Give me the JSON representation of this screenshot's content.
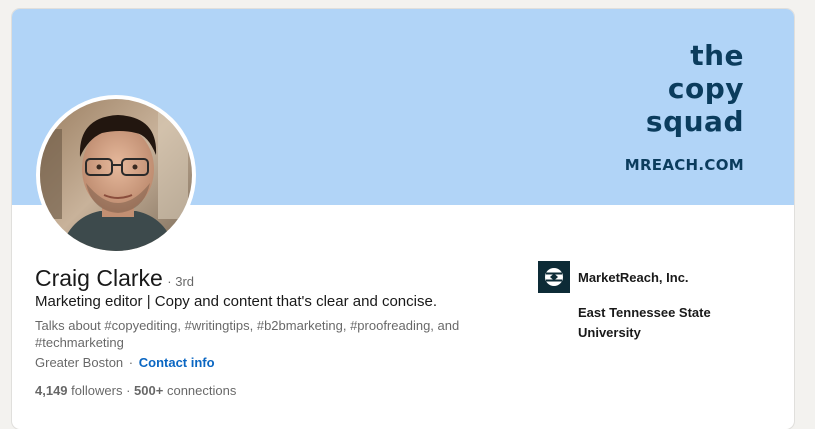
{
  "banner": {
    "brand_lines": [
      "the",
      "copy",
      "squad"
    ],
    "brand_url": "MREACH.COM",
    "background": "#b1d4f7",
    "text_color": "#0b3c5d"
  },
  "profile": {
    "name": "Craig Clarke",
    "degree": "3rd",
    "headline": "Marketing editor | Copy and content that's clear and concise.",
    "talks_about": "Talks about #copyediting, #writingtips, #b2bmarketing, #proofreading, and #techmarketing",
    "location": "Greater Boston",
    "contact_label": "Contact info",
    "followers": "4,149",
    "followers_label": "followers",
    "connections": "500+",
    "connections_label": "connections"
  },
  "sidebar": {
    "company": "MarketReach, Inc.",
    "company_logo_icon": "marketreach-logo-icon",
    "school": "East Tennessee State University"
  },
  "colors": {
    "link": "#0a66c2",
    "logo_bg": "#0d2b36"
  }
}
